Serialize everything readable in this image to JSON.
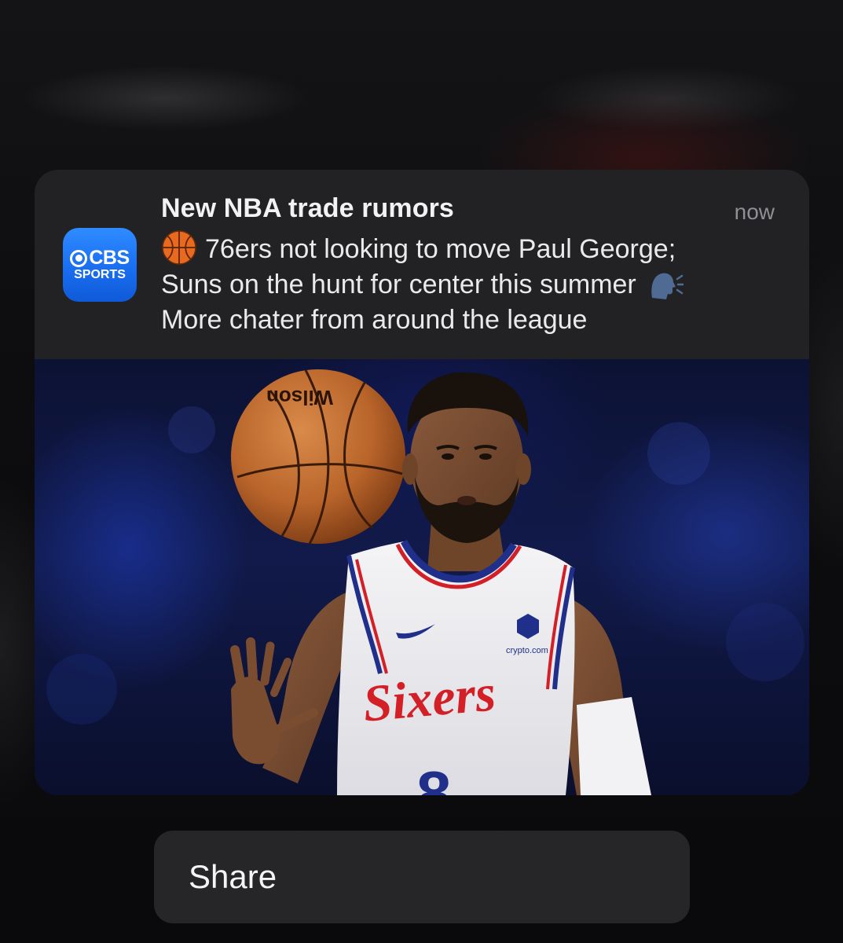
{
  "notification": {
    "app_name": "CBS Sports",
    "app_icon": {
      "top_text": "CBS",
      "bottom_text": "SPORTS",
      "color": "#1f74f5"
    },
    "title": "New NBA trade rumors",
    "time": "now",
    "body": {
      "leading_emoji": "basketball-emoji",
      "line1": "76ers not looking to move Paul George;",
      "line2": "Suns on the hunt for center this summer",
      "trailing_emoji": "speaking-head-emoji",
      "line3": "More chater from around the league"
    },
    "image": {
      "subject": "basketball-player-photo",
      "jersey_text": "Sixers",
      "jersey_number": "8",
      "sponsor": "crypto.com"
    }
  },
  "actions": {
    "share_label": "Share"
  }
}
